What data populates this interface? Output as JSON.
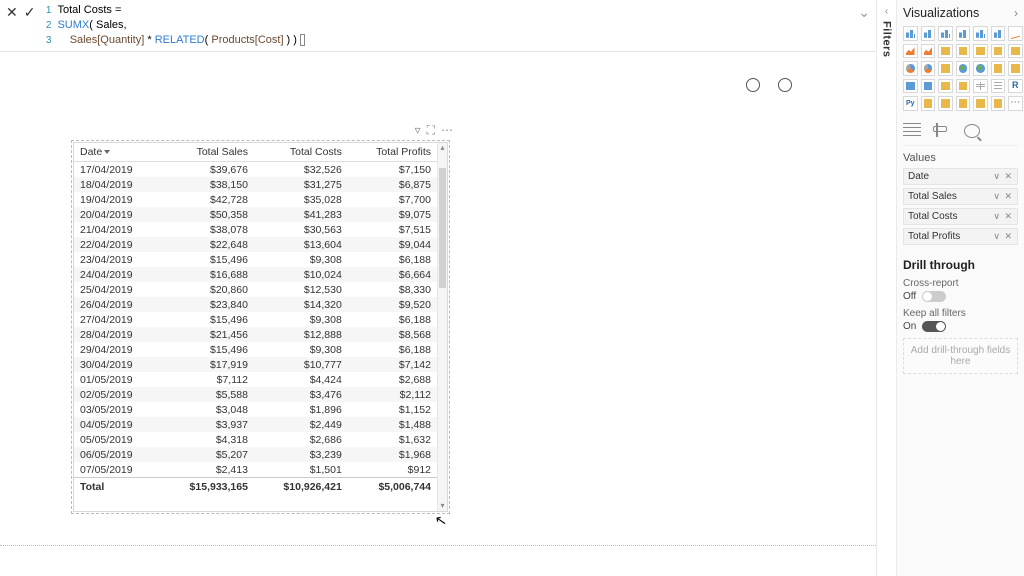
{
  "formula": {
    "lines": [
      {
        "num": "1",
        "prefix": "Total Costs ",
        "op": "="
      },
      {
        "num": "2",
        "fn": "SUMX",
        "open": "( ",
        "ident": "Sales",
        "comma": ","
      },
      {
        "num": "3",
        "indent": "    ",
        "c1": "Sales[Quantity]",
        "times": " * ",
        "fn2": "RELATED",
        "open2": "( ",
        "c2": "Products[Cost]",
        "close": " ) )"
      }
    ]
  },
  "table": {
    "columns": [
      "Date",
      "Total Sales",
      "Total Costs",
      "Total Profits"
    ],
    "rows": [
      [
        "17/04/2019",
        "$39,676",
        "$32,526",
        "$7,150"
      ],
      [
        "18/04/2019",
        "$38,150",
        "$31,275",
        "$6,875"
      ],
      [
        "19/04/2019",
        "$42,728",
        "$35,028",
        "$7,700"
      ],
      [
        "20/04/2019",
        "$50,358",
        "$41,283",
        "$9,075"
      ],
      [
        "21/04/2019",
        "$38,078",
        "$30,563",
        "$7,515"
      ],
      [
        "22/04/2019",
        "$22,648",
        "$13,604",
        "$9,044"
      ],
      [
        "23/04/2019",
        "$15,496",
        "$9,308",
        "$6,188"
      ],
      [
        "24/04/2019",
        "$16,688",
        "$10,024",
        "$6,664"
      ],
      [
        "25/04/2019",
        "$20,860",
        "$12,530",
        "$8,330"
      ],
      [
        "26/04/2019",
        "$23,840",
        "$14,320",
        "$9,520"
      ],
      [
        "27/04/2019",
        "$15,496",
        "$9,308",
        "$6,188"
      ],
      [
        "28/04/2019",
        "$21,456",
        "$12,888",
        "$8,568"
      ],
      [
        "29/04/2019",
        "$15,496",
        "$9,308",
        "$6,188"
      ],
      [
        "30/04/2019",
        "$17,919",
        "$10,777",
        "$7,142"
      ],
      [
        "01/05/2019",
        "$7,112",
        "$4,424",
        "$2,688"
      ],
      [
        "02/05/2019",
        "$5,588",
        "$3,476",
        "$2,112"
      ],
      [
        "03/05/2019",
        "$3,048",
        "$1,896",
        "$1,152"
      ],
      [
        "04/05/2019",
        "$3,937",
        "$2,449",
        "$1,488"
      ],
      [
        "05/05/2019",
        "$4,318",
        "$2,686",
        "$1,632"
      ],
      [
        "06/05/2019",
        "$5,207",
        "$3,239",
        "$1,968"
      ],
      [
        "07/05/2019",
        "$2,413",
        "$1,501",
        "$912"
      ]
    ],
    "total_row": [
      "Total",
      "$15,933,165",
      "$10,926,421",
      "$5,006,744"
    ]
  },
  "viz_pane": {
    "title": "Visualizations",
    "values_label": "Values",
    "wells": [
      "Date",
      "Total Sales",
      "Total Costs",
      "Total Profits"
    ],
    "drill_title": "Drill through",
    "cross_report": "Cross-report",
    "cross_state": "Off",
    "keep_filters": "Keep all filters",
    "keep_state": "On",
    "drop_hint": "Add drill-through fields here"
  },
  "filters_label": "Filters"
}
